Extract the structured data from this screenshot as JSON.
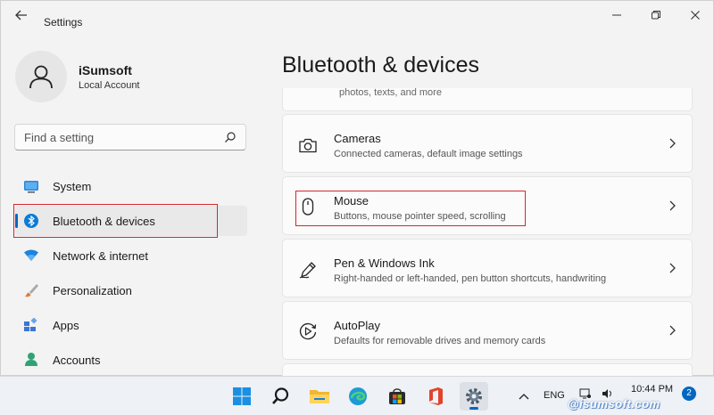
{
  "window": {
    "title": "Settings",
    "back_icon": "back-arrow-icon",
    "controls": [
      "minimize-icon",
      "maximize-icon",
      "close-icon"
    ]
  },
  "profile": {
    "name": "iSumsoft",
    "account_type": "Local Account"
  },
  "search": {
    "placeholder": "Find a setting"
  },
  "sidebar": {
    "items": [
      {
        "label": "System",
        "icon": "system-icon",
        "color": "#0078d4"
      },
      {
        "label": "Bluetooth & devices",
        "icon": "bluetooth-icon",
        "color": "#0078d4",
        "active": true
      },
      {
        "label": "Network & internet",
        "icon": "wifi-icon",
        "color": "#0078d4"
      },
      {
        "label": "Personalization",
        "icon": "brush-icon",
        "color": "#e07b39"
      },
      {
        "label": "Apps",
        "icon": "apps-icon",
        "color": "#3a76d6"
      },
      {
        "label": "Accounts",
        "icon": "accounts-icon",
        "color": "#2fa377"
      }
    ]
  },
  "main": {
    "title": "Bluetooth & devices",
    "partial_top_text": "photos, texts, and more",
    "cards": [
      {
        "title": "Cameras",
        "subtitle": "Connected cameras, default image settings",
        "icon": "camera-icon"
      },
      {
        "title": "Mouse",
        "subtitle": "Buttons, mouse pointer speed, scrolling",
        "icon": "mouse-icon"
      },
      {
        "title": "Pen & Windows Ink",
        "subtitle": "Right-handed or left-handed, pen button shortcuts, handwriting",
        "icon": "pen-icon"
      },
      {
        "title": "AutoPlay",
        "subtitle": "Defaults for removable drives and memory cards",
        "icon": "autoplay-icon"
      }
    ]
  },
  "taskbar": {
    "apps": [
      "windows-start-icon",
      "search-icon",
      "file-explorer-icon",
      "edge-icon",
      "store-icon",
      "office-icon",
      "settings-gear-icon"
    ],
    "language": "ENG",
    "time": "10:44 PM",
    "notification_count": "2"
  },
  "watermark": "@isumsoft.com",
  "colors": {
    "accent": "#0067c0",
    "highlight_box": "#d7262e"
  }
}
